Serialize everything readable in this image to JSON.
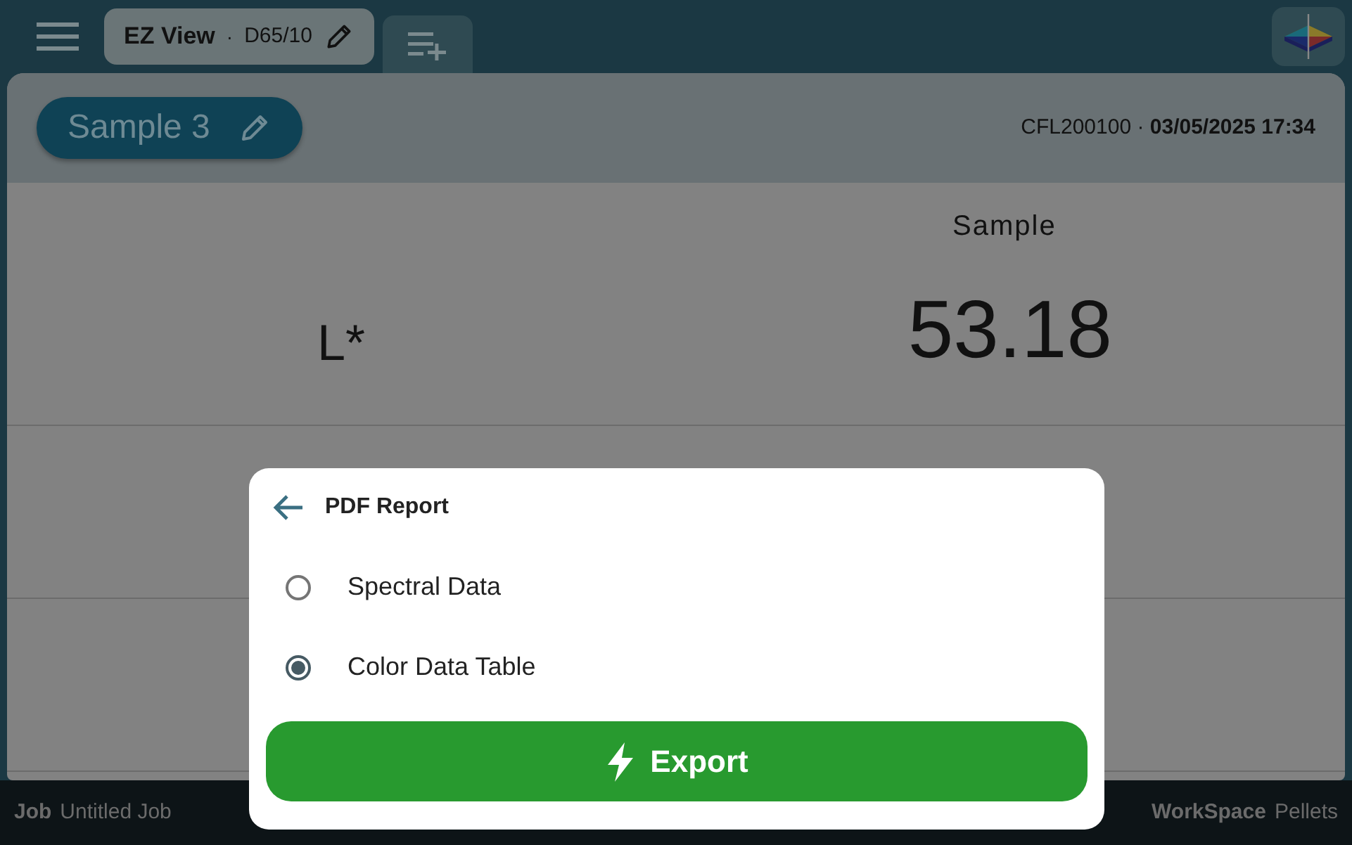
{
  "top_bar": {
    "view_tab": {
      "title": "EZ View",
      "separator": "·",
      "illuminant": "D65/10"
    }
  },
  "sample": {
    "name": "Sample 3",
    "instrument": "CFL200100",
    "separator": "·",
    "timestamp": "03/05/2025 17:34"
  },
  "table": {
    "column_header": "Sample",
    "rows": [
      {
        "label": "L*",
        "value": "53.18"
      }
    ]
  },
  "footer": {
    "job_label": "Job",
    "job": "Untitled Job",
    "workspace_label": "WorkSpace",
    "workspace": "Pellets"
  },
  "dialog": {
    "title": "PDF Report",
    "options": [
      {
        "label": "Spectral Data",
        "selected": false
      },
      {
        "label": "Color Data Table",
        "selected": true
      }
    ],
    "button": "Export"
  }
}
